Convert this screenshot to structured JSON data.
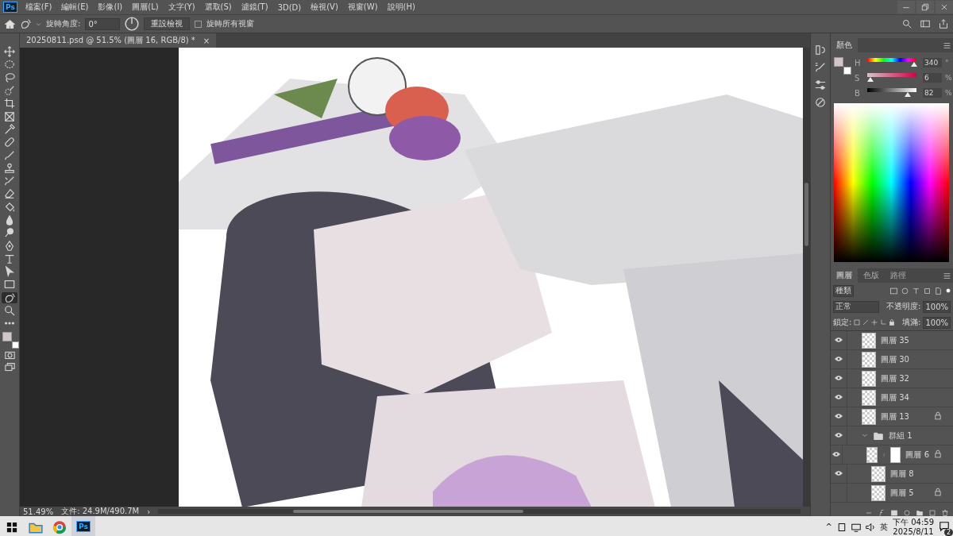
{
  "app": {
    "logo": "Ps"
  },
  "menu": [
    "檔案(F)",
    "編輯(E)",
    "影像(I)",
    "圖層(L)",
    "文字(Y)",
    "選取(S)",
    "濾鏡(T)",
    "3D(D)",
    "檢視(V)",
    "視窗(W)",
    "說明(H)"
  ],
  "options": {
    "angle_label": "旋轉角度:",
    "angle_value": "0°",
    "reset_button": "重設檢視",
    "rotate_all": {
      "label": "旋轉所有視窗",
      "checked": false
    }
  },
  "document_tab": {
    "title": "20250811.psd @ 51.5% (圖層 16, RGB/8) *",
    "close": "×"
  },
  "tools": [
    {
      "kind": "move",
      "selected": false
    },
    {
      "kind": "marquee",
      "selected": false
    },
    {
      "kind": "lasso",
      "selected": false
    },
    {
      "kind": "quick-select",
      "selected": false
    },
    {
      "kind": "crop",
      "selected": false
    },
    {
      "kind": "frame",
      "selected": false
    },
    {
      "kind": "eyedropper",
      "selected": false
    },
    {
      "kind": "bandage",
      "selected": false
    },
    {
      "kind": "brush",
      "selected": false
    },
    {
      "kind": "stamp",
      "selected": false
    },
    {
      "kind": "history-brush",
      "selected": false
    },
    {
      "kind": "eraser",
      "selected": false
    },
    {
      "kind": "bucket",
      "selected": false
    },
    {
      "kind": "drop",
      "selected": false
    },
    {
      "kind": "dodge",
      "selected": false
    },
    {
      "kind": "pen",
      "selected": false
    },
    {
      "kind": "type",
      "selected": false
    },
    {
      "kind": "pointer",
      "selected": false
    },
    {
      "kind": "rectangle",
      "selected": false
    },
    {
      "kind": "rotate-view",
      "selected": true
    },
    {
      "kind": "zoom",
      "selected": false
    },
    {
      "kind": "more",
      "selected": false
    }
  ],
  "swatches": [
    {
      "kind": "foreground",
      "color": "#d1c5c9"
    },
    {
      "kind": "background",
      "color": "#ffffff"
    }
  ],
  "status_bar": {
    "zoom": "51.49%",
    "file": "文件: 24.9M/490.7M",
    "arrow": "›"
  },
  "color_panel": {
    "tab": "顏色",
    "sliders": [
      {
        "label": "H",
        "value": "340",
        "unit": "°",
        "level": 0.944
      },
      {
        "label": "S",
        "value": "6",
        "unit": "%",
        "level": 0.06
      },
      {
        "label": "B",
        "value": "82",
        "unit": "%",
        "level": 0.82
      }
    ]
  },
  "layers_panel": {
    "tabs": [
      {
        "label": "圖層",
        "selected": true
      },
      {
        "label": "色版",
        "selected": false
      },
      {
        "label": "路徑",
        "selected": false
      }
    ],
    "filter": "種類",
    "blend_mode": "正常",
    "opacity_label": "不透明度:",
    "opacity": "100%",
    "lock_label": "鎖定:",
    "fill_label": "填滿:",
    "fill": "100%",
    "layers": [
      {
        "kind": "layer",
        "name": "圖層 35",
        "visible": true,
        "locked": false
      },
      {
        "kind": "layer",
        "name": "圖層 30",
        "visible": true,
        "locked": false
      },
      {
        "kind": "layer",
        "name": "圖層 32",
        "visible": true,
        "locked": false
      },
      {
        "kind": "layer",
        "name": "圖層 34",
        "visible": true,
        "locked": false
      },
      {
        "kind": "layer",
        "name": "圖層 13",
        "visible": true,
        "locked": true
      },
      {
        "kind": "group",
        "name": "群組 1",
        "visible": true,
        "locked": false,
        "expanded": true,
        "children": [
          {
            "kind": "masked",
            "name": "圖層 6",
            "visible": true,
            "locked": true
          },
          {
            "kind": "layer",
            "name": "圖層 8",
            "visible": true,
            "locked": false
          },
          {
            "kind": "layer",
            "name": "圖層 5",
            "visible": false,
            "locked": true
          }
        ]
      }
    ]
  },
  "taskbar": {
    "apps": [
      {
        "kind": "explorer",
        "selected": false
      },
      {
        "kind": "browser",
        "selected": false
      },
      {
        "kind": "photoshop",
        "label": "Ps",
        "selected": true
      }
    ],
    "tray_caret": "^",
    "ime": "英",
    "time": "下午 04:59",
    "date": "2025/8/11",
    "notifications": "2"
  }
}
